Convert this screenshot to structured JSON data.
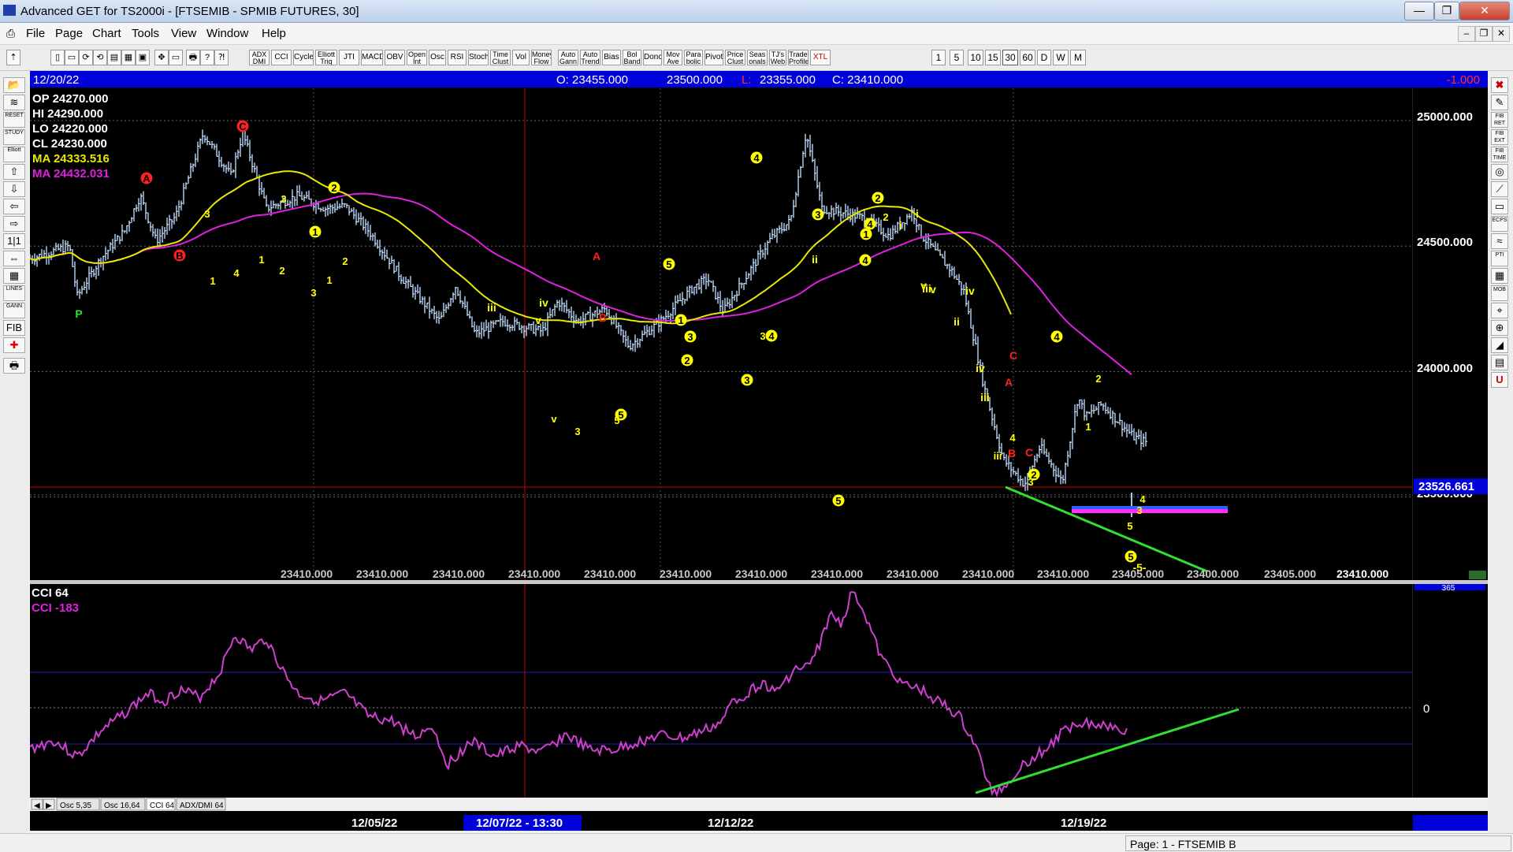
{
  "window": {
    "title": "Advanced GET for TS2000i - [FTSEMIB - SPMIB FUTURES, 30]",
    "controls": [
      "—",
      "❐",
      "✕"
    ]
  },
  "menu": [
    "File",
    "Page",
    "Chart",
    "Tools",
    "View",
    "Window",
    "Help"
  ],
  "toolbar": {
    "studies": [
      "ADX DMI",
      "CCI",
      "Cycles",
      "Elliott Trig",
      "JTI",
      "MACD",
      "OBV",
      "Open Int",
      "Osc",
      "RSI",
      "Stoch",
      "Time Clust",
      "Vol",
      "Money Flow",
      "Auto Gann",
      "Auto Trend",
      "Bias",
      "Bol Band",
      "Donch",
      "Mov Ave",
      "Para bolic",
      "Pivot",
      "Price Clust",
      "Seas onals",
      "TJ's Web",
      "Trade Profile",
      "XTL"
    ],
    "intervals": [
      "1",
      "5",
      "10",
      "15",
      "30",
      "60",
      "D",
      "W",
      "M"
    ],
    "selected_interval": "30"
  },
  "left_tools": [
    "📂",
    "≋",
    "RESET",
    "STUDY",
    "Elliott",
    "⇧",
    "⇩",
    "⇦",
    "⇨",
    "1|1",
    "⇔",
    "▦",
    "LINES",
    "GANN",
    "FIB",
    "✚",
    "🖶"
  ],
  "right_tools": [
    "✖",
    "✎",
    "FIB RET",
    "FIB EXT",
    "FIB TIME",
    "◎",
    "⟋",
    "▭",
    "ECPS",
    "≈",
    "PTI",
    "▦",
    "MOB",
    "⌖",
    "⊕",
    "◢",
    "▤",
    "U"
  ],
  "chart": {
    "info_bar": {
      "date": "12/20/22",
      "open": "O: 23455.000",
      "high": "23500.000",
      "low_label": "L:",
      "low": "23355.000",
      "close": "C: 23410.000",
      "change": "-1.000"
    },
    "ohlc_legend": {
      "op": "OP  24270.000",
      "hi": "HI   24290.000",
      "lo": "LO  24220.000",
      "cl": "CL  24230.000",
      "ma1": "MA  24333.516",
      "ma2": "MA  24432.031"
    },
    "price_axis": [
      "25000.000",
      "24500.000",
      "24000.000",
      "23500.000"
    ],
    "cursor_price": "23526.661",
    "bottom_value_labels": [
      "23410.000",
      "23410.000",
      "23410.000",
      "23410.000",
      "23410.000",
      "23410.000",
      "23410.000",
      "23410.000",
      "23410.000",
      "23410.000",
      "23410.000",
      "23405.000",
      "23400.000",
      "23405.000",
      "23410.000"
    ],
    "date_axis": [
      "12/05/22",
      "12/07/22 - 13:30",
      "12/12/22",
      "12/19/22"
    ],
    "osc_title": "CCI 64",
    "osc_value": "CCI  -183",
    "osc_axis_top": "365",
    "osc_axis_zero": "0",
    "osc_tabs": [
      "Osc 5,35",
      "Osc 16,64",
      "CCI 64",
      "ADX/DMI 64"
    ],
    "selected_tab": "CCI 64",
    "colors": {
      "background": "#000000",
      "bars": "#a9c8ea",
      "ma_fast": "#e8e800",
      "ma_slow": "#e020e0",
      "cci": "#d040d0",
      "trend": "#30e030",
      "wave_yellow": "#ffff00",
      "wave_red": "#ff2020",
      "crosshair": "#c00000"
    },
    "wave_labels": [
      {
        "t": "P",
        "c": "green",
        "circle": false
      },
      {
        "t": "A",
        "c": "red",
        "circle": true
      },
      {
        "t": "B",
        "c": "red",
        "circle": true
      },
      {
        "t": "C",
        "c": "red",
        "circle": true
      },
      {
        "t": "1",
        "c": "yellow",
        "circle": true
      },
      {
        "t": "2",
        "c": "yellow",
        "circle": true
      },
      {
        "t": "3",
        "c": "yellow",
        "circle": true
      },
      {
        "t": "4",
        "c": "yellow",
        "circle": true
      },
      {
        "t": "5",
        "c": "yellow",
        "circle": true
      },
      {
        "t": "5",
        "c": "yellow",
        "circle": true
      },
      {
        "t": "5",
        "c": "yellow",
        "circle": true
      },
      {
        "t": "4",
        "c": "yellow",
        "circle": true
      },
      {
        "t": "2",
        "c": "yellow",
        "circle": true
      },
      {
        "t": "1",
        "c": "yellow",
        "circle": true
      },
      {
        "t": "3",
        "c": "yellow",
        "circle": true
      },
      {
        "t": "2",
        "c": "yellow",
        "circle": true
      },
      {
        "t": "4",
        "c": "yellow",
        "circle": true
      },
      {
        "t": "5",
        "c": "yellow",
        "circle": true
      },
      {
        "t": "4",
        "c": "yellow",
        "circle": true
      },
      {
        "t": "2",
        "c": "yellow",
        "circle": true
      },
      {
        "t": "1",
        "c": "yellow",
        "circle": true
      },
      {
        "t": "3",
        "c": "yellow",
        "circle": true
      },
      {
        "t": "4",
        "c": "yellow",
        "circle": true
      },
      {
        "t": "C",
        "c": "red",
        "circle": false
      },
      {
        "t": "A",
        "c": "red",
        "circle": false
      },
      {
        "t": "B",
        "c": "red",
        "circle": false
      },
      {
        "t": "A",
        "c": "red",
        "circle": false
      },
      {
        "t": "B",
        "c": "red",
        "circle": false
      },
      {
        "t": "C",
        "c": "red",
        "circle": false
      },
      {
        "t": "iii",
        "c": "yellow",
        "circle": false
      },
      {
        "t": "iv",
        "c": "yellow",
        "circle": false
      },
      {
        "t": "v",
        "c": "yellow",
        "circle": false
      },
      {
        "t": "ii",
        "c": "yellow",
        "circle": false
      },
      {
        "t": "i",
        "c": "yellow",
        "circle": false
      },
      {
        "t": "iii",
        "c": "yellow",
        "circle": false
      },
      {
        "t": "iv",
        "c": "yellow",
        "circle": false
      },
      {
        "t": "v",
        "c": "yellow",
        "circle": false
      },
      {
        "t": "ii",
        "c": "yellow",
        "circle": false
      },
      {
        "t": "i",
        "c": "yellow",
        "circle": false
      },
      {
        "t": "iii",
        "c": "yellow",
        "circle": false
      },
      {
        "t": "iv",
        "c": "yellow",
        "circle": false
      },
      {
        "t": "v",
        "c": "yellow",
        "circle": false
      },
      {
        "t": "-5-",
        "c": "yellow",
        "circle": false
      }
    ]
  },
  "status": {
    "page": "Page: 1 - FTSEMIB B"
  }
}
